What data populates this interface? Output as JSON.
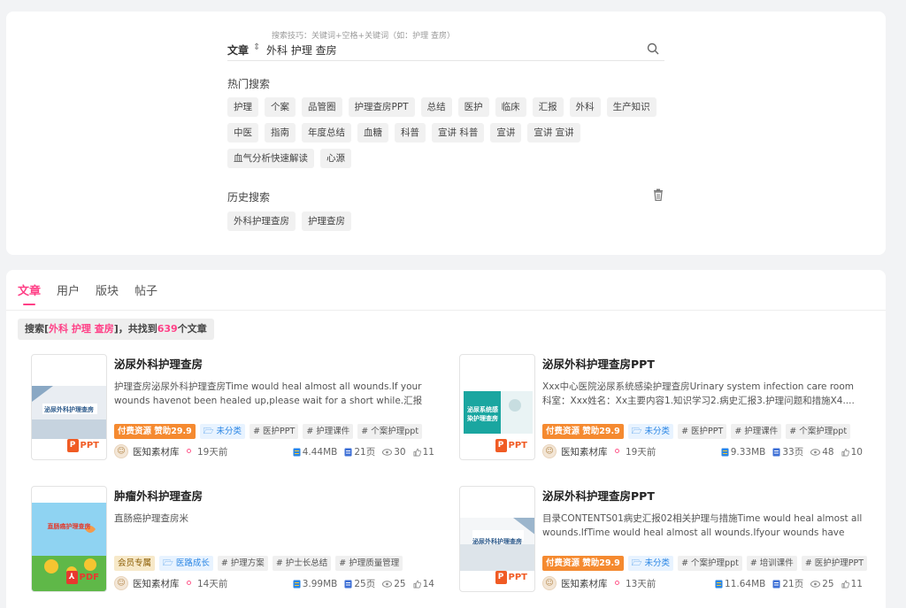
{
  "search": {
    "tips": "搜索技巧：关键词+空格+关键词（如：护理 查房）",
    "scope": "文章",
    "query": "外科 护理 查房"
  },
  "hot": {
    "title": "热门搜索",
    "tags": [
      "护理",
      "个案",
      "品管圈",
      "护理查房PPT",
      "总结",
      "医护",
      "临床",
      "汇报",
      "外科",
      "生产知识",
      "中医",
      "指南",
      "年度总结",
      "血糖",
      "科普",
      "宣讲 科普",
      "宣讲",
      "宣讲 宣讲",
      "血气分析快速解读",
      "心源"
    ]
  },
  "history": {
    "title": "历史搜索",
    "tags": [
      "外科护理查房",
      "护理查房"
    ]
  },
  "tabs": [
    "文章",
    "用户",
    "版块",
    "帖子"
  ],
  "summary": {
    "prefix": "搜索[",
    "query": "外科 护理 查房",
    "middle": "]，共找到",
    "count": "639",
    "suffix": "个文章"
  },
  "results": [
    {
      "title": "泌尿外科护理查房",
      "desc": "护理查房泌尿外科护理查房Time would heal almost all wounds.If your wounds havenot been healed up,please wait for a short while.汇报人：...",
      "thumb_text": "泌尿外科护理查房",
      "format": "PPT",
      "tags": [
        {
          "label": "付费资源 赞助29.9",
          "kind": "paid"
        },
        {
          "label": "🗁 未分类",
          "kind": "cat"
        },
        {
          "label": "# 医护PPT",
          "kind": "plain"
        },
        {
          "label": "# 护理课件",
          "kind": "plain"
        },
        {
          "label": "# 个案护理ppt",
          "kind": "plain"
        }
      ],
      "author": "医知素材库",
      "time": "19天前",
      "size": "4.44MB",
      "pages": "21页",
      "views": "30",
      "likes": "11"
    },
    {
      "title": "泌尿外科护理查房PPT",
      "desc": "Xxx中心医院泌尿系统感染护理查房Urinary system infection care room科室：Xxx姓名：Xx主要内容1.知识学习2.病史汇报3.护理问题和措施X4....",
      "thumb_text": "泌尿系统感染护理查房",
      "format": "PPT",
      "tags": [
        {
          "label": "付费资源 赞助29.9",
          "kind": "paid"
        },
        {
          "label": "🗁 未分类",
          "kind": "cat"
        },
        {
          "label": "# 医护PPT",
          "kind": "plain"
        },
        {
          "label": "# 护理课件",
          "kind": "plain"
        },
        {
          "label": "# 个案护理ppt",
          "kind": "plain"
        }
      ],
      "author": "医知素材库",
      "time": "19天前",
      "size": "9.33MB",
      "pages": "33页",
      "views": "48",
      "likes": "10"
    },
    {
      "title": "肿瘤外科护理查房",
      "desc": "直肠癌护理查房米",
      "thumb_text": "直肠癌护理查房",
      "format": "PDF",
      "tags": [
        {
          "label": "会员专属",
          "kind": "member"
        },
        {
          "label": "🗁 医路成长",
          "kind": "cat"
        },
        {
          "label": "# 护理方案",
          "kind": "plain"
        },
        {
          "label": "# 护士长总结",
          "kind": "plain"
        },
        {
          "label": "# 护理质量管理",
          "kind": "plain"
        }
      ],
      "author": "医知素材库",
      "time": "14天前",
      "size": "3.99MB",
      "pages": "25页",
      "views": "25",
      "likes": "14"
    },
    {
      "title": "泌尿外科护理查房PPT",
      "desc": "目录CONTENTS01病史汇报02相关护理与措施Time would heal almost all wounds.IfTime would heal almost all wounds.Ifyour wounds have not...",
      "thumb_text": "泌尿外科护理查房",
      "format": "PPT",
      "tags": [
        {
          "label": "付费资源 赞助29.9",
          "kind": "paid"
        },
        {
          "label": "🗁 未分类",
          "kind": "cat"
        },
        {
          "label": "# 个案护理ppt",
          "kind": "plain"
        },
        {
          "label": "# 培训课件",
          "kind": "plain"
        },
        {
          "label": "# 医护护理PPT",
          "kind": "plain"
        }
      ],
      "author": "医知素材库",
      "time": "13天前",
      "size": "11.64MB",
      "pages": "21页",
      "views": "25",
      "likes": "11"
    }
  ]
}
